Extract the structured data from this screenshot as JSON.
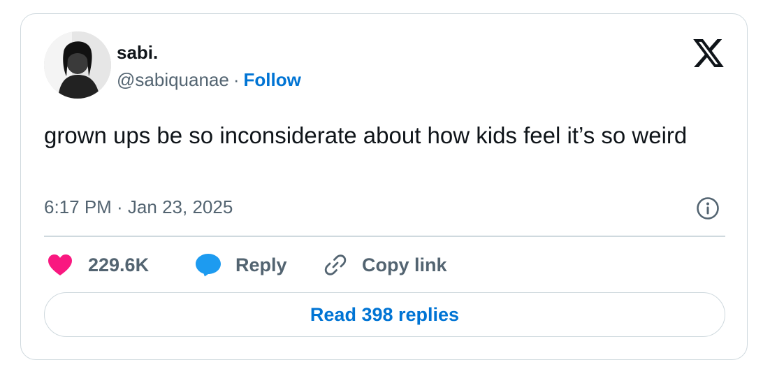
{
  "author": {
    "display_name": "sabi.",
    "handle": "@sabiquanae",
    "separator": "·",
    "follow_label": "Follow"
  },
  "tweet": {
    "text": "grown ups be so inconsiderate about how kids feel it’s so weird",
    "timestamp": "6:17 PM · Jan 23, 2025"
  },
  "actions": {
    "like_count": "229.6K",
    "reply_label": "Reply",
    "copy_link_label": "Copy link"
  },
  "read_replies_label": "Read 398 replies",
  "icons": {
    "brand": "x-logo-icon",
    "info": "info-icon",
    "like": "heart-icon",
    "reply": "speech-bubble-icon",
    "copy": "link-icon"
  },
  "colors": {
    "text_primary": "#0f1419",
    "text_secondary": "#536471",
    "link": "#0074d4",
    "heart": "#f91880",
    "reply_bubble": "#1d9bf0",
    "border": "#cfd9de"
  }
}
